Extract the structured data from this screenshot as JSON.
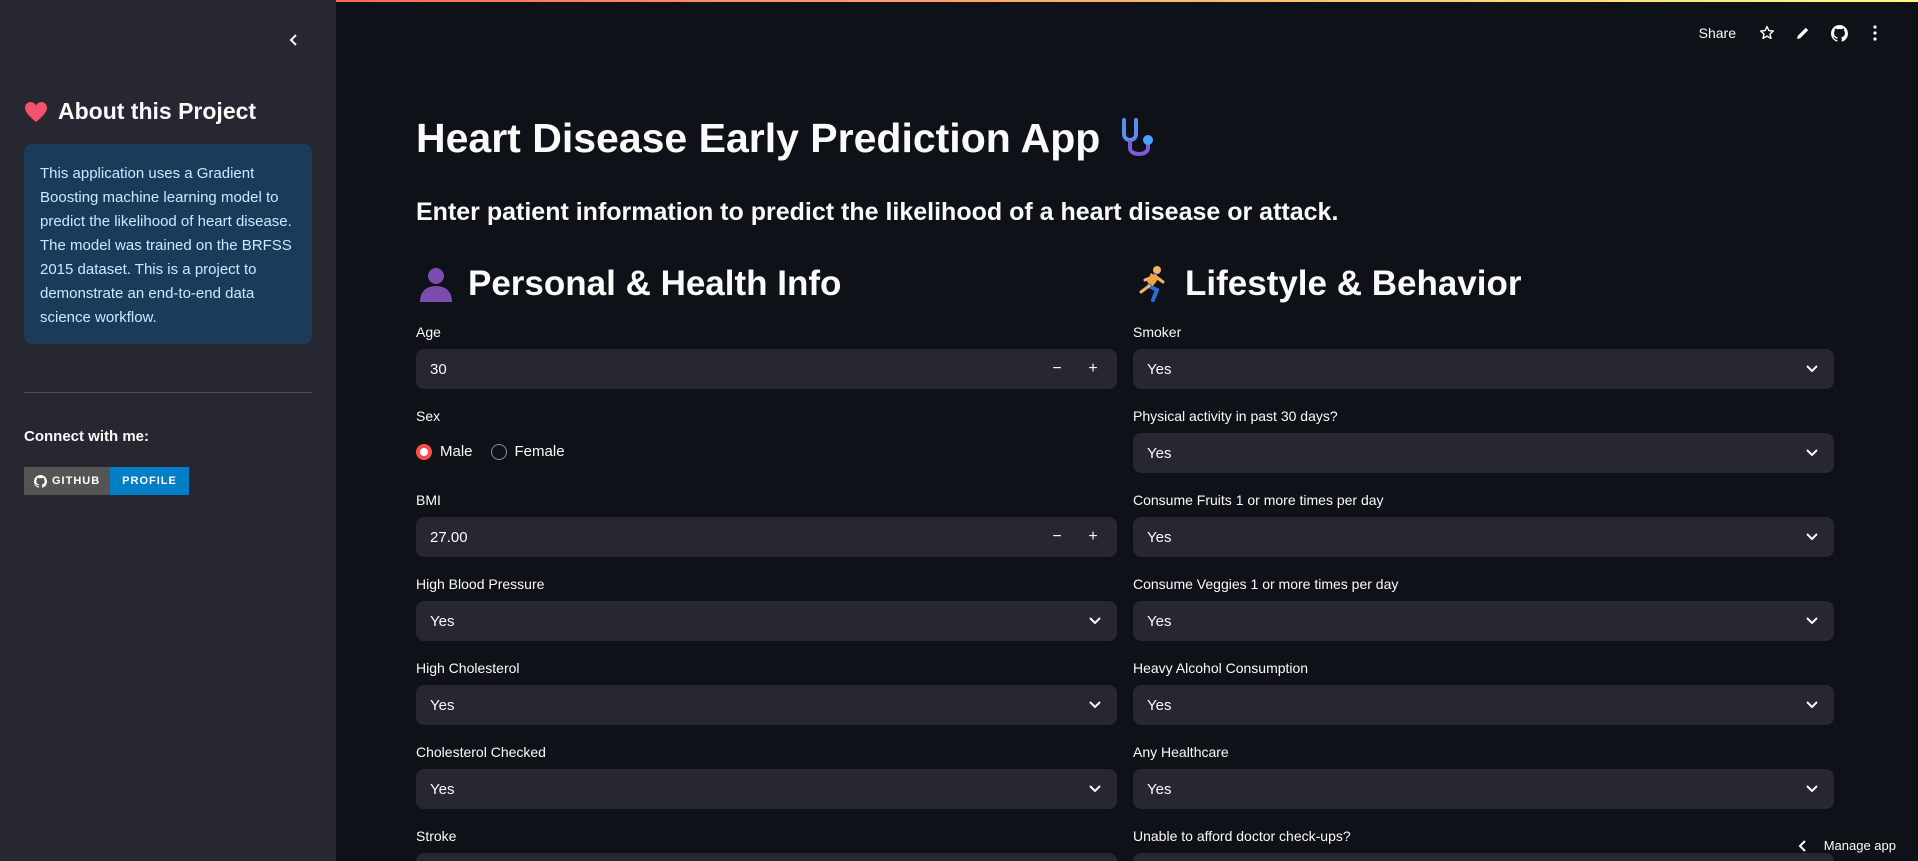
{
  "sidebar": {
    "title": "About this Project",
    "info": "This application uses a Gradient Boosting machine learning model to predict the likelihood of heart disease. The model was trained on the BRFSS 2015 dataset. This is a project to demonstrate an end-to-end data science workflow.",
    "connect": "Connect with me:",
    "badge_left": "GITHUB",
    "badge_right": "PROFILE"
  },
  "toolbar": {
    "share": "Share"
  },
  "main": {
    "title": "Heart Disease Early Prediction App",
    "subheader": "Enter patient information to predict the likelihood of a heart disease or attack.",
    "left_header": "Personal & Health Info",
    "right_header": "Lifestyle & Behavior"
  },
  "left": {
    "age_label": "Age",
    "age_value": "30",
    "sex_label": "Sex",
    "sex_options": [
      "Male",
      "Female"
    ],
    "sex_selected": "Male",
    "bmi_label": "BMI",
    "bmi_value": "27.00",
    "bp_label": "High Blood Pressure",
    "bp_value": "Yes",
    "chol_label": "High Cholesterol",
    "chol_value": "Yes",
    "cholcheck_label": "Cholesterol Checked",
    "cholcheck_value": "Yes",
    "stroke_label": "Stroke"
  },
  "right": {
    "smoker_label": "Smoker",
    "smoker_value": "Yes",
    "phys_label": "Physical activity in past 30 days?",
    "phys_value": "Yes",
    "fruits_label": "Consume Fruits 1 or more times per day",
    "fruits_value": "Yes",
    "veggies_label": "Consume Veggies 1 or more times per day",
    "veggies_value": "Yes",
    "alcohol_label": "Heavy Alcohol Consumption",
    "alcohol_value": "Yes",
    "healthcare_label": "Any Healthcare",
    "healthcare_value": "Yes",
    "doctor_label": "Unable to afford doctor check-ups?"
  },
  "footer": {
    "manage": "Manage app"
  },
  "colors": {
    "accent": "#ff4b4b",
    "bg": "#0e1117",
    "sidebar": "#262730",
    "info": "#1c3a5a"
  }
}
